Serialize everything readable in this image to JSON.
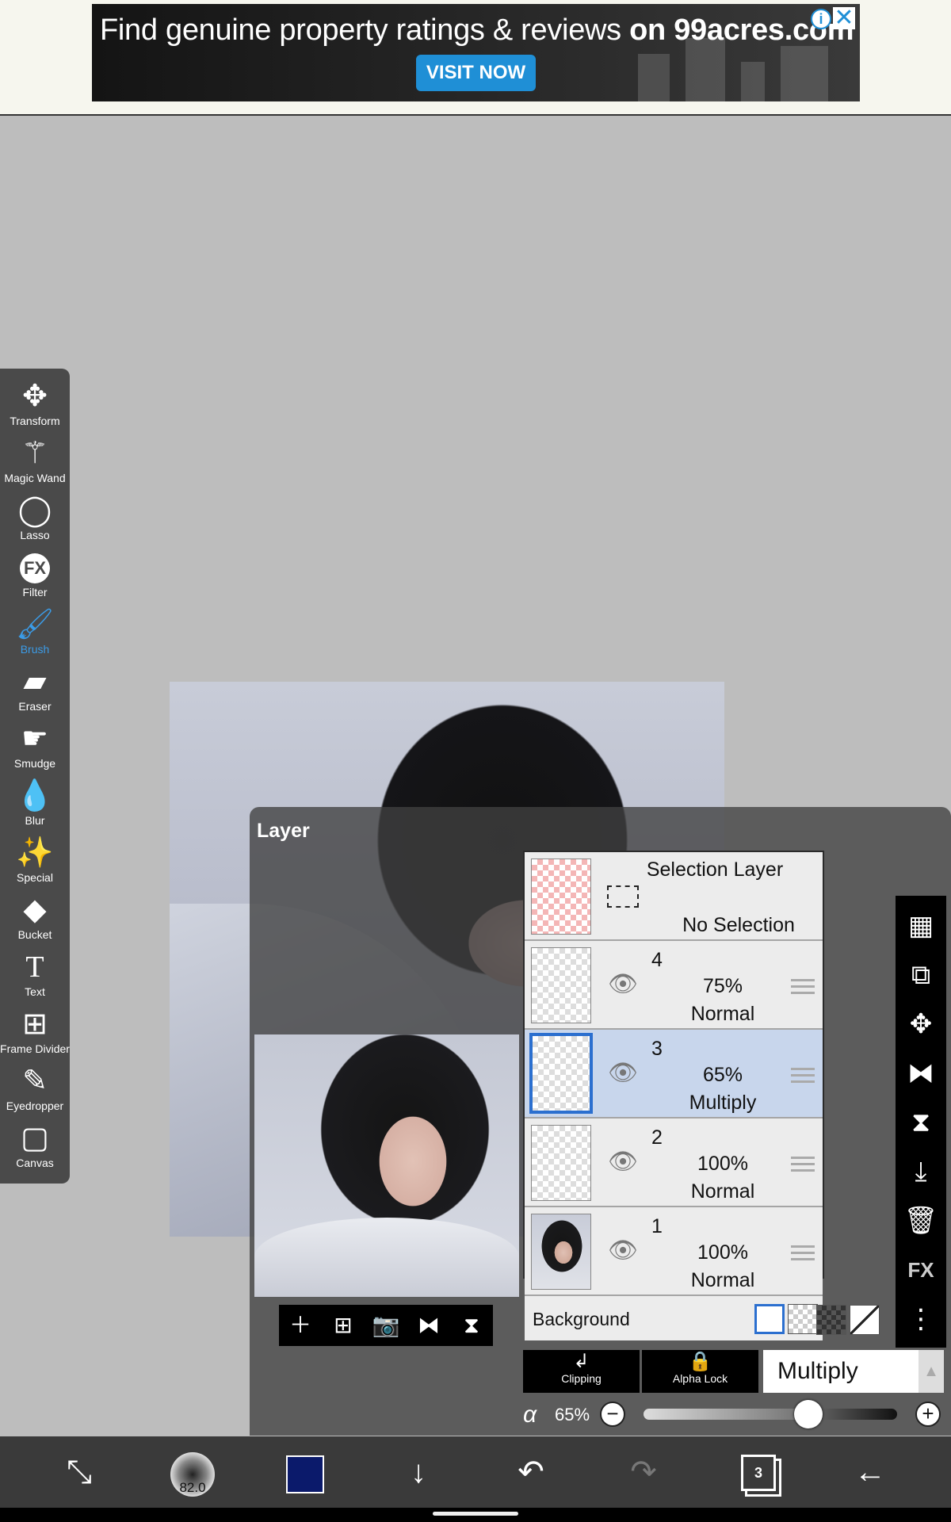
{
  "ad": {
    "headline_part1": "Find genuine property ratings & reviews",
    "headline_part2": "on 99acres.com",
    "cta": "VISIT NOW",
    "info_icon": "info-icon",
    "close_icon": "close-icon"
  },
  "toolbar": {
    "tools": [
      {
        "label": "Transform",
        "icon": "move-arrows-icon"
      },
      {
        "label": "Magic Wand",
        "icon": "magic-wand-icon"
      },
      {
        "label": "Lasso",
        "icon": "lasso-icon"
      },
      {
        "label": "Filter",
        "icon": "fx-icon"
      },
      {
        "label": "Brush",
        "icon": "brush-icon",
        "active": true
      },
      {
        "label": "Eraser",
        "icon": "eraser-icon"
      },
      {
        "label": "Smudge",
        "icon": "smudge-icon"
      },
      {
        "label": "Blur",
        "icon": "droplet-icon"
      },
      {
        "label": "Special",
        "icon": "sparkle-pen-icon"
      },
      {
        "label": "Bucket",
        "icon": "bucket-icon"
      },
      {
        "label": "Text",
        "icon": "text-icon"
      },
      {
        "label": "Frame Divider",
        "icon": "frame-divider-icon"
      },
      {
        "label": "Eyedropper",
        "icon": "eyedropper-icon"
      },
      {
        "label": "Canvas",
        "icon": "canvas-icon"
      }
    ],
    "accent_color": "#3b9be6"
  },
  "layer_panel": {
    "title": "Layer",
    "selection_layer": {
      "title": "Selection Layer",
      "status": "No Selection"
    },
    "layers": [
      {
        "number": "4",
        "opacity": "75%",
        "mode": "Normal",
        "selected": false
      },
      {
        "number": "3",
        "opacity": "65%",
        "mode": "Multiply",
        "selected": true
      },
      {
        "number": "2",
        "opacity": "100%",
        "mode": "Normal",
        "selected": false
      },
      {
        "number": "1",
        "opacity": "100%",
        "mode": "Normal",
        "selected": false
      }
    ],
    "background_label": "Background",
    "clipping_label": "Clipping",
    "alpha_lock_label": "Alpha Lock",
    "blend_mode": "Multiply",
    "alpha_symbol": "α",
    "opacity_value": "65%",
    "opacity_fraction": 0.65,
    "selected_color": "#c8d6ec"
  },
  "bottom_bar": {
    "brush_size": "82.0",
    "current_color": "#0b1a6b",
    "layer_count": "3"
  }
}
